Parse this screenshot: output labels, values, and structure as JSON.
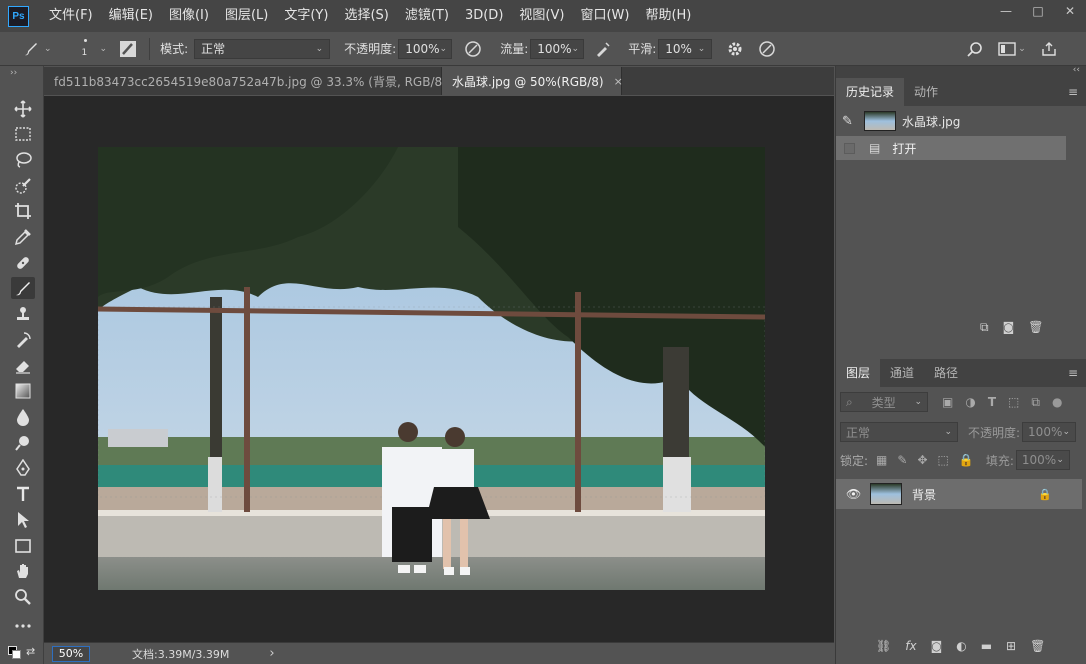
{
  "app": {
    "logo": "Ps"
  },
  "menu": [
    "文件(F)",
    "编辑(E)",
    "图像(I)",
    "图层(L)",
    "文字(Y)",
    "选择(S)",
    "滤镜(T)",
    "3D(D)",
    "视图(V)",
    "窗口(W)",
    "帮助(H)"
  ],
  "window_controls": {
    "minimize": "—",
    "restore": "□",
    "close": "✕"
  },
  "options": {
    "brush_size": "1",
    "mode_label": "模式:",
    "mode_value": "正常",
    "opacity_label": "不透明度:",
    "opacity_value": "100%",
    "flow_label": "流量:",
    "flow_value": "100%",
    "smooth_label": "平滑:",
    "smooth_value": "10%"
  },
  "tabs": [
    {
      "label": "fd511b83473cc2654519e80a752a47b.jpg @ 33.3% (背景, RGB/8) *",
      "close": "×"
    },
    {
      "label": "水晶球.jpg @ 50%(RGB/8)",
      "close": "×"
    }
  ],
  "status": {
    "zoom": "50%",
    "doc": "文档:3.39M/3.39M",
    "arrow": "›"
  },
  "history_panel": {
    "tabs": [
      "历史记录",
      "动作"
    ],
    "snapshot": "水晶球.jpg",
    "steps": [
      "打开"
    ]
  },
  "layers_panel": {
    "tabs": [
      "图层",
      "通道",
      "路径"
    ],
    "filter_label": "类型",
    "blend_mode": "正常",
    "opacity_label": "不透明度:",
    "opacity_value": "100%",
    "lock_label": "锁定:",
    "fill_label": "填充:",
    "fill_value": "100%",
    "layers": [
      {
        "name": "背景",
        "visible": true,
        "locked": true
      }
    ]
  },
  "colors": {
    "accent": "#31a8ff",
    "panel_bg": "#535353",
    "canvas_bg": "#282828",
    "selected_row": "#707070"
  }
}
